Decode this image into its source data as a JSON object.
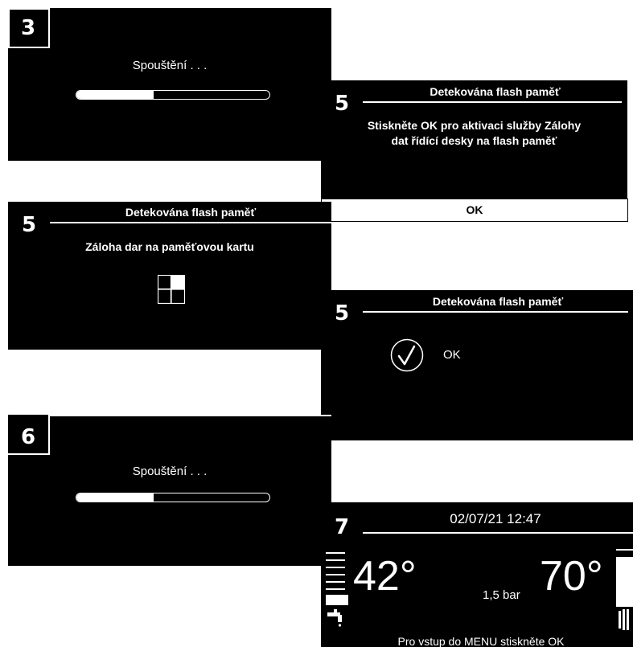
{
  "screen3": {
    "step": "3",
    "message": "Spouštění . . .",
    "progress": 0.4
  },
  "screen5a": {
    "step": "5",
    "title": "Detekována flash paměť",
    "message_line1": "Stiskněte OK pro aktivaci služby Zálohy",
    "message_line2": "dat řídící desky na flash paměť",
    "ok_label": "OK"
  },
  "screen5b": {
    "step": "5",
    "title": "Detekována flash paměť",
    "message": "Záloha dar na paměťovou kartu"
  },
  "screen5c": {
    "step": "5",
    "title": "Detekována flash paměť",
    "status": "OK"
  },
  "screen6": {
    "step": "6",
    "message": "Spouštění . . .",
    "progress": 0.4
  },
  "screen7": {
    "step": "7",
    "datetime": "02/07/21 12:47",
    "temp_left": "42°",
    "pressure": "1,5 bar",
    "temp_right": "70°",
    "footer": "Pro vstup do MENU stiskněte OK",
    "icons": {
      "left": "tap-icon",
      "right": "radiator-icon"
    }
  }
}
